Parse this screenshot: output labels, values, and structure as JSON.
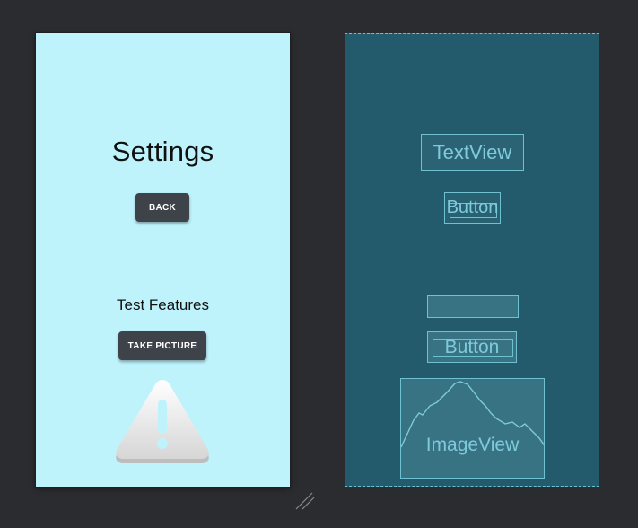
{
  "design": {
    "title": "Settings",
    "back_button_label": "BACK",
    "subtitle": "Test Features",
    "take_picture_label": "TAKE PICTURE",
    "image_icon": "warning-triangle-icon",
    "background_color": "#bff3fc",
    "button_color": "#3d4349"
  },
  "blueprint": {
    "textview_label": "TextView",
    "button_back_label": "Button",
    "button_take_label": "Button",
    "imageview_label": "ImageView",
    "background_color": "#245b6c",
    "outline_color": "#6fc1d2"
  },
  "canvas": {
    "background_color": "#2b2c30",
    "resize_icon": "resize-grip-icon"
  }
}
